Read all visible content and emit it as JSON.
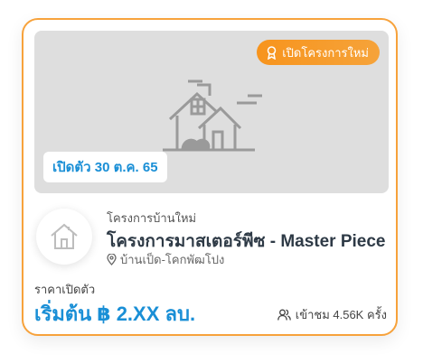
{
  "badge": {
    "label": "เปิดโครงการใหม่",
    "color": "#f7941d",
    "icon": "award-icon"
  },
  "open_date": {
    "label": "เปิดตัว 30 ต.ค. 65"
  },
  "project": {
    "category": "โครงการบ้านใหม่",
    "title": "โครงการมาสเตอร์พีซ - Master Piece",
    "location": "บ้านเป็ด-โคกพัฒโปง",
    "location_icon": "map-pin-icon",
    "avatar_icon": "house-icon"
  },
  "price": {
    "label": "ราคาเปิดตัว",
    "value": "เริ่มต้น ฿ 2.XX ลบ.",
    "color": "#1a8fd6"
  },
  "views": {
    "text": "เข้าชม 4.56K ครั้ง",
    "icon": "users-icon"
  },
  "colors": {
    "border": "#f7a23b",
    "placeholder_bg": "#dedede"
  }
}
